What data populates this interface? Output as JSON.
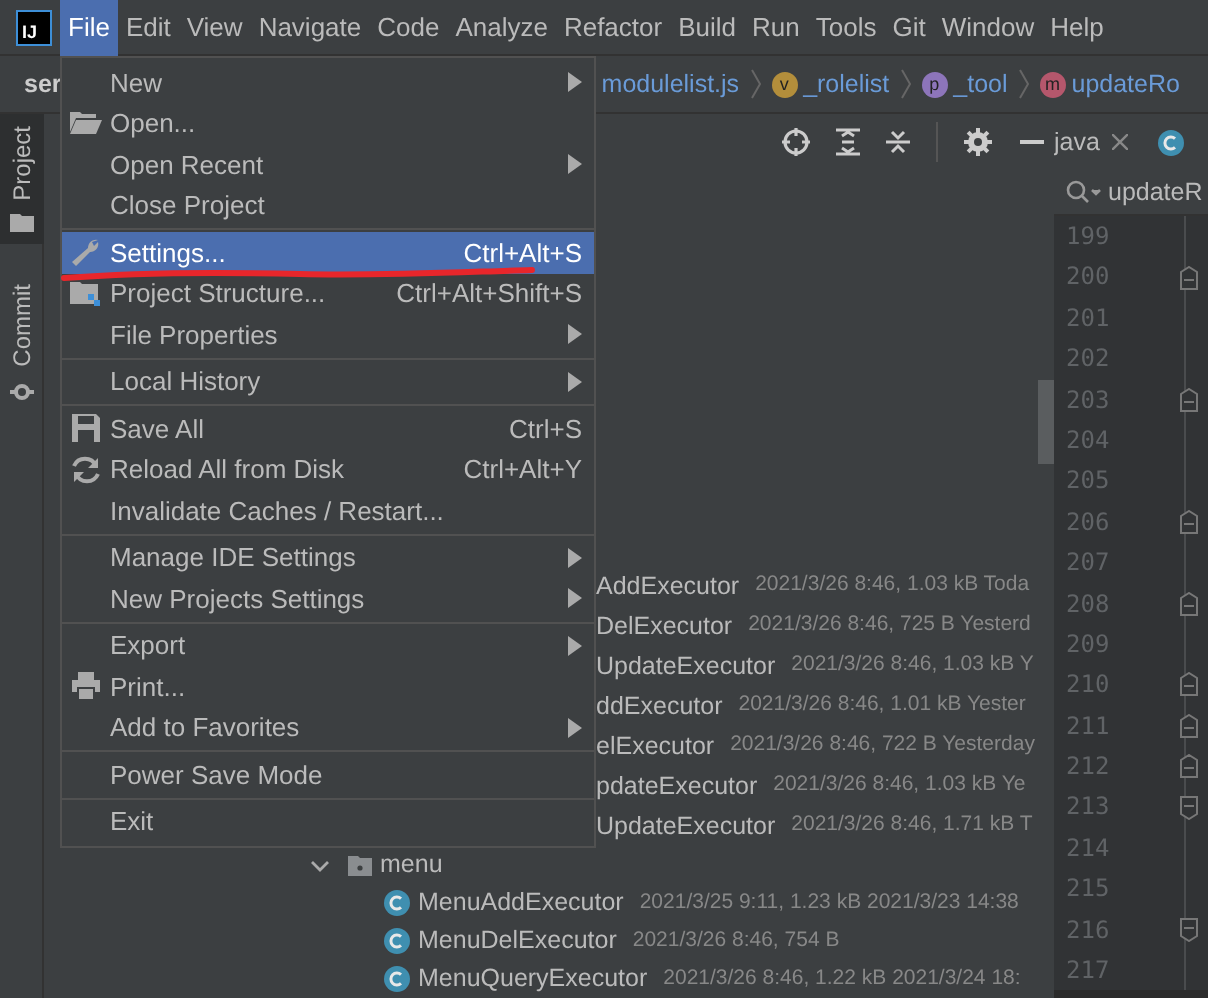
{
  "menubar": {
    "logo": "IJ",
    "items": [
      {
        "label": "File",
        "selected": true
      },
      {
        "label": "Edit",
        "selected": false
      },
      {
        "label": "View",
        "selected": false
      },
      {
        "label": "Navigate",
        "selected": false
      },
      {
        "label": "Code",
        "selected": false
      },
      {
        "label": "Analyze",
        "selected": false
      },
      {
        "label": "Refactor",
        "selected": false
      },
      {
        "label": "Build",
        "selected": false
      },
      {
        "label": "Run",
        "selected": false
      },
      {
        "label": "Tools",
        "selected": false
      },
      {
        "label": "Git",
        "selected": false
      },
      {
        "label": "Window",
        "selected": false
      },
      {
        "label": "Help",
        "selected": false
      }
    ]
  },
  "navbar": {
    "project": "ser",
    "breadcrumbs": [
      {
        "kind": "file",
        "label": "modulelist.js"
      },
      {
        "kind": "variable",
        "badge": "v",
        "label": "_rolelist",
        "color": "#b38e3b"
      },
      {
        "kind": "property",
        "badge": "p",
        "label": "_tool",
        "color": "#8d75ba"
      },
      {
        "kind": "method",
        "badge": "m",
        "label": "updateRo",
        "color": "#b5576c"
      }
    ]
  },
  "tool_strip": [
    {
      "label": "Project",
      "selected": true
    },
    {
      "label": "Commit",
      "selected": false
    }
  ],
  "file_menu": [
    {
      "kind": "item",
      "label": "New",
      "submenu": true,
      "selected": false
    },
    {
      "kind": "item",
      "label": "Open...",
      "selected": false
    },
    {
      "kind": "item",
      "label": "Open Recent",
      "submenu": true,
      "selected": false
    },
    {
      "kind": "item",
      "label": "Close Project",
      "selected": false
    },
    {
      "kind": "separator"
    },
    {
      "kind": "item",
      "label": "Settings...",
      "shortcut": "Ctrl+Alt+S",
      "selected": true
    },
    {
      "kind": "item",
      "label": "Project Structure...",
      "shortcut": "Ctrl+Alt+Shift+S",
      "selected": false
    },
    {
      "kind": "item",
      "label": "File Properties",
      "submenu": true,
      "selected": false
    },
    {
      "kind": "separator"
    },
    {
      "kind": "item",
      "label": "Local History",
      "submenu": true,
      "selected": false
    },
    {
      "kind": "separator"
    },
    {
      "kind": "item",
      "label": "Save All",
      "shortcut": "Ctrl+S",
      "selected": false
    },
    {
      "kind": "item",
      "label": "Reload All from Disk",
      "shortcut": "Ctrl+Alt+Y",
      "selected": false
    },
    {
      "kind": "item",
      "label": "Invalidate Caches / Restart...",
      "selected": false
    },
    {
      "kind": "separator"
    },
    {
      "kind": "item",
      "label": "Manage IDE Settings",
      "submenu": true,
      "selected": false
    },
    {
      "kind": "item",
      "label": "New Projects Settings",
      "submenu": true,
      "selected": false
    },
    {
      "kind": "separator"
    },
    {
      "kind": "item",
      "label": "Export",
      "submenu": true,
      "selected": false
    },
    {
      "kind": "item",
      "label": "Print...",
      "selected": false
    },
    {
      "kind": "item",
      "label": "Add to Favorites",
      "submenu": true,
      "selected": false
    },
    {
      "kind": "separator"
    },
    {
      "kind": "item",
      "label": "Power Save Mode",
      "selected": false
    },
    {
      "kind": "separator"
    },
    {
      "kind": "item",
      "label": "Exit",
      "selected": false
    }
  ],
  "project_tree": [
    {
      "kind": "hidden",
      "name": "AddExecutor",
      "details": "2021/3/26 8:46, 1.03 kB Toda"
    },
    {
      "kind": "hidden",
      "name": "DelExecutor",
      "details": "2021/3/26 8:46, 725 B Yesterd"
    },
    {
      "kind": "hidden",
      "name": "UpdateExecutor",
      "details": "2021/3/26 8:46, 1.03 kB Y"
    },
    {
      "kind": "hidden",
      "name": "ddExecutor",
      "details": "2021/3/26 8:46, 1.01 kB Yester"
    },
    {
      "kind": "hidden",
      "name": "elExecutor",
      "details": "2021/3/26 8:46, 722 B Yesterday"
    },
    {
      "kind": "hidden",
      "name": "pdateExecutor",
      "details": "2021/3/26 8:46, 1.03 kB Ye"
    },
    {
      "kind": "hidden",
      "name": "UpdateExecutor",
      "details": "2021/3/26 8:46, 1.71 kB T"
    },
    {
      "kind": "folder",
      "name": "menu",
      "expanded": true
    },
    {
      "kind": "class",
      "name": "MenuAddExecutor",
      "details": "2021/3/25 9:11, 1.23 kB  2021/3/23 14:38"
    },
    {
      "kind": "class",
      "name": "MenuDelExecutor",
      "details": "2021/3/26 8:46, 754 B"
    },
    {
      "kind": "class",
      "name": "MenuQueryExecutor",
      "details": "2021/3/26 8:46, 1.22 kB  2021/3/24 18:"
    }
  ],
  "editor": {
    "tab": "java",
    "search": "updateR",
    "lines": [
      {
        "number": "199",
        "kind": "plain"
      },
      {
        "number": "200",
        "kind": "fold_start"
      },
      {
        "number": "201",
        "kind": "plain"
      },
      {
        "number": "202",
        "kind": "plain"
      },
      {
        "number": "203",
        "kind": "fold_start"
      },
      {
        "number": "204",
        "kind": "plain"
      },
      {
        "number": "205",
        "kind": "plain"
      },
      {
        "number": "206",
        "kind": "fold_start"
      },
      {
        "number": "207",
        "kind": "plain"
      },
      {
        "number": "208",
        "kind": "fold_start"
      },
      {
        "number": "209",
        "kind": "plain"
      },
      {
        "number": "210",
        "kind": "fold_start"
      },
      {
        "number": "211",
        "kind": "fold_start"
      },
      {
        "number": "212",
        "kind": "fold_start"
      },
      {
        "number": "213",
        "kind": "fold_end"
      },
      {
        "number": "214",
        "kind": "plain"
      },
      {
        "number": "215",
        "kind": "plain"
      },
      {
        "number": "216",
        "kind": "fold_end"
      },
      {
        "number": "217",
        "kind": "plain"
      }
    ]
  }
}
